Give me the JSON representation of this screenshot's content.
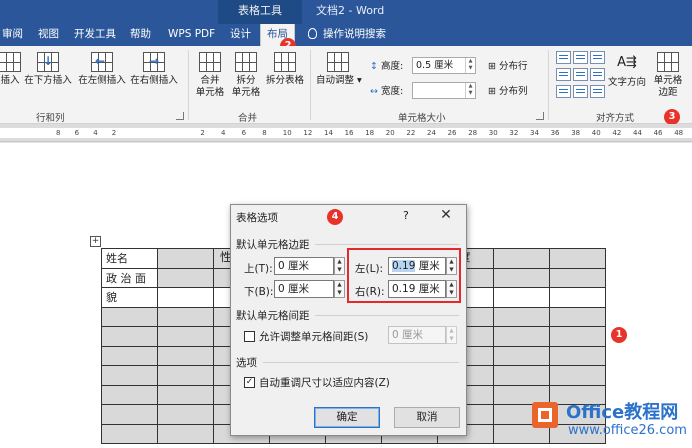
{
  "titlebar": {
    "context_tab": "表格工具",
    "doc_title": "文档2 - Word"
  },
  "tabs": [
    "审阅",
    "视图",
    "开发工具",
    "帮助",
    "WPS PDF",
    "设计",
    "布局"
  ],
  "tell_me": "操作说明搜索",
  "ribbon": {
    "rows_cols": {
      "insert_above": "插入",
      "insert_below": "在下方插入",
      "insert_left": "在左侧插入",
      "insert_right": "在右侧插入",
      "label": "行和列"
    },
    "merge": {
      "merge_cells": [
        "合并",
        "单元格"
      ],
      "split_cells": [
        "拆分",
        "单元格"
      ],
      "split_table": "拆分表格",
      "label": "合并"
    },
    "cell_size": {
      "autofit": "自动调整",
      "height_label": "高度:",
      "height_value": "0.5 厘米",
      "width_label": "宽度:",
      "width_value": "",
      "distribute_rows": "分布行",
      "distribute_cols": "分布列",
      "label": "单元格大小"
    },
    "alignment": {
      "text_direction": "文字方向",
      "cell_margins": [
        "单元格",
        "边距"
      ],
      "label": "对齐方式"
    }
  },
  "ruler_labels": [
    "8",
    "6",
    "4",
    "2",
    "2",
    "4",
    "6",
    "8",
    "10",
    "12",
    "14",
    "16",
    "18",
    "20",
    "22",
    "24",
    "26",
    "28",
    "30",
    "32",
    "34",
    "36",
    "38",
    "40",
    "42",
    "44",
    "46",
    "48"
  ],
  "document": {
    "cell_name": "姓名",
    "cell_politics": [
      "政 治 面",
      "貌"
    ],
    "partial_labels": [
      "性",
      "度"
    ]
  },
  "dialog": {
    "title": "表格选项",
    "help": "?",
    "close": "✕",
    "default_margins_title": "默认单元格边距",
    "top_label": "上(T):",
    "top_value": "0 厘米",
    "bottom_label": "下(B):",
    "bottom_value": "0 厘米",
    "left_label": "左(L):",
    "left_value_num": "0.19",
    "left_value_unit": " 厘米",
    "right_label": "右(R):",
    "right_value": "0.19 厘米",
    "spacing_title": "默认单元格间距",
    "allow_spacing_label": "允许调整单元格间距(S)",
    "spacing_value": "0 厘米",
    "options_title": "选项",
    "auto_resize_label": "自动重调尺寸以适应内容(Z)",
    "ok_label": "确定",
    "cancel_label": "取消"
  },
  "badges": {
    "b1": "1",
    "b2": "2",
    "b3": "3",
    "b4": "4"
  },
  "watermark": {
    "title": "Office教程网",
    "url": "www.office26.com"
  },
  "colors": {
    "accent": "#2b579a",
    "highlight": "#e3292c"
  }
}
